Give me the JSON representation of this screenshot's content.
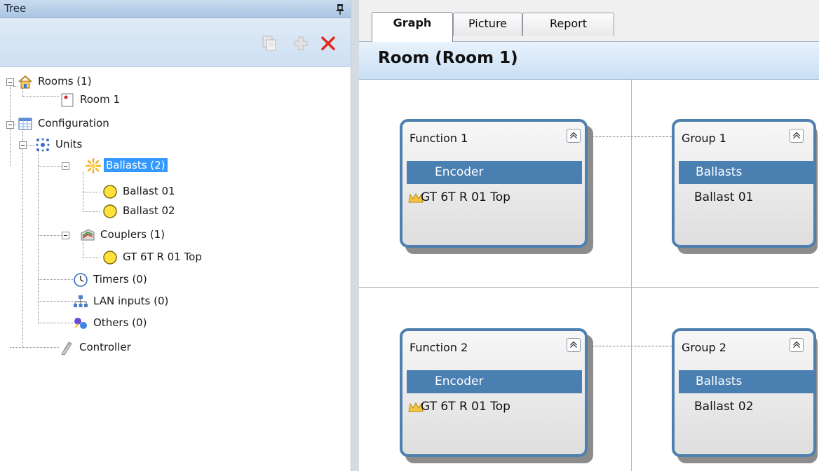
{
  "tree_panel": {
    "title": "Tree",
    "toolbar": {
      "copy_icon": "copy-icon",
      "add_icon": "plus-icon",
      "delete_icon": "delete-icon"
    },
    "nodes": [
      {
        "label": "Rooms (1)",
        "icon": "house-icon"
      },
      {
        "label": "Room 1",
        "icon": "room-icon"
      },
      {
        "label": "Configuration",
        "icon": "table-icon"
      },
      {
        "label": "Units",
        "icon": "units-icon"
      },
      {
        "label": "Ballasts (2)",
        "icon": "sunburst-icon",
        "selected": true
      },
      {
        "label": "Ballast 01",
        "icon": "yellow-circle-icon"
      },
      {
        "label": "Ballast 02",
        "icon": "yellow-circle-icon"
      },
      {
        "label": "Couplers (1)",
        "icon": "coupler-icon"
      },
      {
        "label": "GT 6T R 01 Top",
        "icon": "yellow-circle-icon"
      },
      {
        "label": "Timers (0)",
        "icon": "clock-icon"
      },
      {
        "label": "LAN inputs (0)",
        "icon": "network-icon"
      },
      {
        "label": "Others (0)",
        "icon": "puzzle-icon"
      },
      {
        "label": "Controller",
        "icon": "controller-icon"
      }
    ]
  },
  "tabs": [
    {
      "label": "Graph",
      "active": true
    },
    {
      "label": "Picture",
      "active": false
    },
    {
      "label": "Report",
      "active": false
    }
  ],
  "room_header": {
    "title": "Room (Room 1)"
  },
  "cards": [
    {
      "title": "Function 1",
      "band": "Encoder",
      "item": "GT 6T R 01 Top",
      "item_icon": "crown-icon"
    },
    {
      "title": "Group 1",
      "band": "Ballasts",
      "item": "Ballast 01"
    },
    {
      "title": "Function 2",
      "band": "Encoder",
      "item": "GT 6T R 01 Top",
      "item_icon": "crown-icon"
    },
    {
      "title": "Group 2",
      "band": "Ballasts",
      "item": "Ballast 02"
    }
  ],
  "colors": {
    "accent_blue": "#4a7fb2",
    "selection_blue": "#3399ff",
    "card_border": "#4f7fae",
    "header_gradient": "#c9dff4"
  }
}
